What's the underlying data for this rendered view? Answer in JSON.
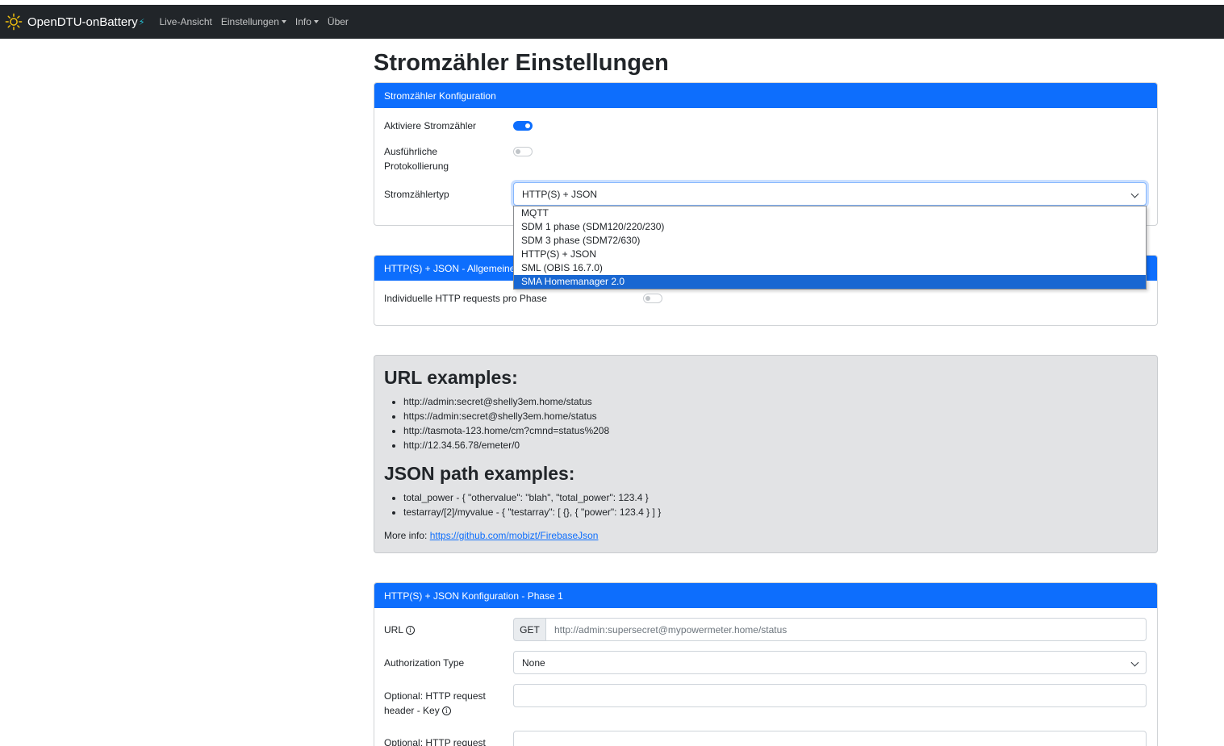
{
  "nav": {
    "brand": "OpenDTU-onBattery",
    "items": [
      {
        "label": "Live-Ansicht",
        "dropdown": false
      },
      {
        "label": "Einstellungen",
        "dropdown": true
      },
      {
        "label": "Info",
        "dropdown": true
      },
      {
        "label": "Über",
        "dropdown": false
      }
    ]
  },
  "page_title": "Stromzähler Einstellungen",
  "config_card": {
    "header": "Stromzähler Konfiguration",
    "enable_label": "Aktiviere Stromzähler",
    "enable_on": true,
    "verbose_label_1": "Ausführliche",
    "verbose_label_2": "Protokollierung",
    "verbose_on": false,
    "type_label": "Stromzählertyp",
    "type_value": "HTTP(S) + JSON",
    "type_options": [
      "MQTT",
      "SDM 1 phase (SDM120/220/230)",
      "SDM 3 phase (SDM72/630)",
      "HTTP(S) + JSON",
      "SML (OBIS 16.7.0)",
      "SMA Homemanager 2.0"
    ],
    "highlighted_option": "SMA Homemanager 2.0"
  },
  "general_card": {
    "header": "HTTP(S) + JSON - Allgemeine",
    "individual_label": "Individuelle HTTP requests pro Phase",
    "individual_on": false
  },
  "examples": {
    "url_title": "URL examples:",
    "urls": [
      "http://admin:secret@shelly3em.home/status",
      "https://admin:secret@shelly3em.home/status",
      "http://tasmota-123.home/cm?cmnd=status%208",
      "http://12.34.56.78/emeter/0"
    ],
    "json_title": "JSON path examples:",
    "paths": [
      "total_power - { \"othervalue\": \"blah\", \"total_power\": 123.4 }",
      "testarray/[2]/myvalue - { \"testarray\": [ {}, { \"power\": 123.4 } ] }"
    ],
    "more_label": "More info:",
    "more_link": "https://github.com/mobizt/FirebaseJson"
  },
  "phase1_card": {
    "header": "HTTP(S) + JSON Konfiguration - Phase 1",
    "url_label": "URL",
    "method": "GET",
    "url_placeholder": "http://admin:supersecret@mypowermeter.home/status",
    "auth_label": "Authorization Type",
    "auth_value": "None",
    "header_key_label_1": "Optional: HTTP request",
    "header_key_label_2": "header - Key",
    "header_value_label_1": "Optional: HTTP request"
  },
  "colors": {
    "navbar": "#212529",
    "primary": "#0d6efd",
    "well": "#e2e3e5",
    "highlight": "#1967d2"
  }
}
